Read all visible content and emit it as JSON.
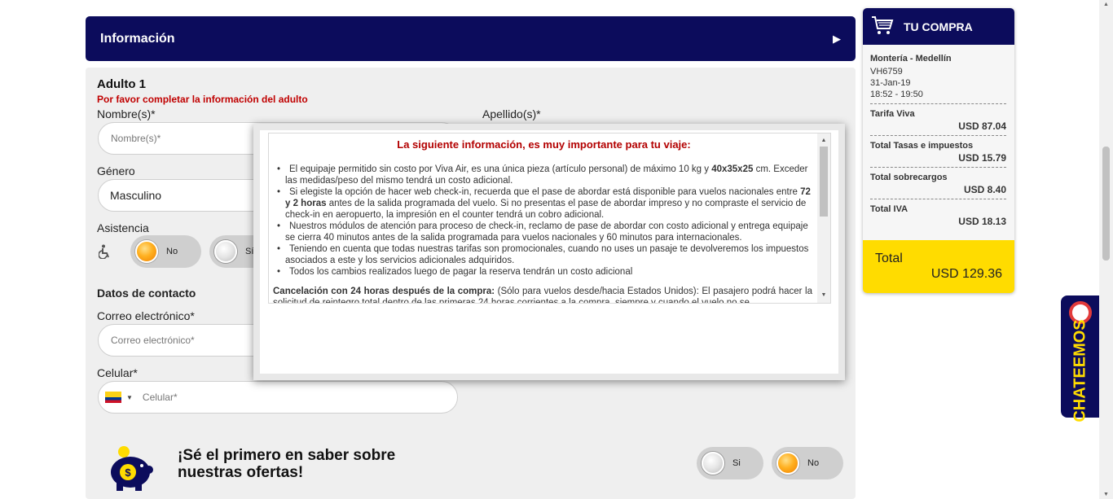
{
  "info_bar": {
    "title": "Información",
    "arrow": "▶"
  },
  "adult": {
    "heading": "Adulto 1",
    "warning": "Por favor completar la información del adulto",
    "name_label": "Nombre(s)*",
    "name_placeholder": "Nombre(s)*",
    "surname_label": "Apellido(s)*",
    "gender_label": "Género",
    "gender_value": "Masculino",
    "assistance_label": "Asistencia",
    "assistance_no": "No",
    "assistance_yes": "Sí"
  },
  "contact": {
    "heading": "Datos de contacto",
    "email_label": "Correo electrónico*",
    "email_placeholder": "Correo electrónico*",
    "phone_label": "Celular*",
    "phone_placeholder": "Celular*"
  },
  "promo": {
    "text": "¡Sé el primero en saber sobre nuestras ofertas!",
    "yes": "Si",
    "no": "No"
  },
  "modal": {
    "title": "La siguiente información, es muy importante para tu viaje:",
    "items": [
      {
        "pre": "El equipaje permitido sin costo por Viva Air, es una única pieza (artículo personal) de máximo 10 kg y ",
        "bold": "40x35x25",
        "post": " cm. Exceder las medidas/peso del mismo tendrá un costo adicional."
      },
      {
        "pre": "Si elegiste la opción de hacer web check-in, recuerda que el pase de abordar está disponible para vuelos nacionales entre ",
        "bold": "72 y 2 horas",
        "post": " antes de la salida programada del  vuelo. Si no presentas el pase de abordar impreso y no compraste el servicio de check-in en aeropuerto, la impresión en el counter tendrá un cobro adicional."
      },
      {
        "pre": "Nuestros módulos de atención para proceso de check-in, reclamo de pase de abordar con costo adicional y entrega equipaje se cierra 40 minutos antes de la salida programada para vuelos nacionales y 60 minutos para internacionales.",
        "bold": "",
        "post": ""
      },
      {
        "pre": "Teniendo en cuenta que todas nuestras tarifas son promocionales, cuando no uses un pasaje te devolveremos los impuestos asociados a este y los servicios adicionales adquiridos.",
        "bold": "",
        "post": ""
      },
      {
        "pre": "Todos los cambios realizados luego de pagar la reserva tendrán un costo adicional",
        "bold": "",
        "post": ""
      }
    ],
    "cancel_bold": "Cancelación con 24 horas después de la compra:",
    "cancel_text": " (Sólo para vuelos desde/hacia Estados Unidos): El pasajero podrá hacer la solicitud de reintegro total dentro de las primeras 24 horas corrientes a la compra, siempre y cuando el vuelo no se"
  },
  "cart": {
    "title": "TU COMPRA",
    "route": "Montería - Medellín",
    "flight": "VH6759",
    "date": "31-Jan-19",
    "time": "18:52 - 19:50",
    "rows": [
      {
        "label": "Tarifa Viva",
        "value": "USD 87.04"
      },
      {
        "label": "Total Tasas e impuestos",
        "value": "USD 15.79"
      },
      {
        "label": "Total sobrecargos",
        "value": "USD 8.40"
      },
      {
        "label": "Total IVA",
        "value": "USD 18.13"
      }
    ],
    "total_label": "Total",
    "total_value": "USD 129.36"
  },
  "chat": {
    "label": "CHATEEMOS"
  },
  "colors": {
    "navy": "#0c0c5c",
    "yellow": "#ffdc00",
    "warning_red": "#c00000"
  },
  "icons": [
    "cart-icon",
    "wheelchair-icon",
    "piggy-bank-icon",
    "colombia-flag-icon",
    "chat-bubble-icon"
  ]
}
